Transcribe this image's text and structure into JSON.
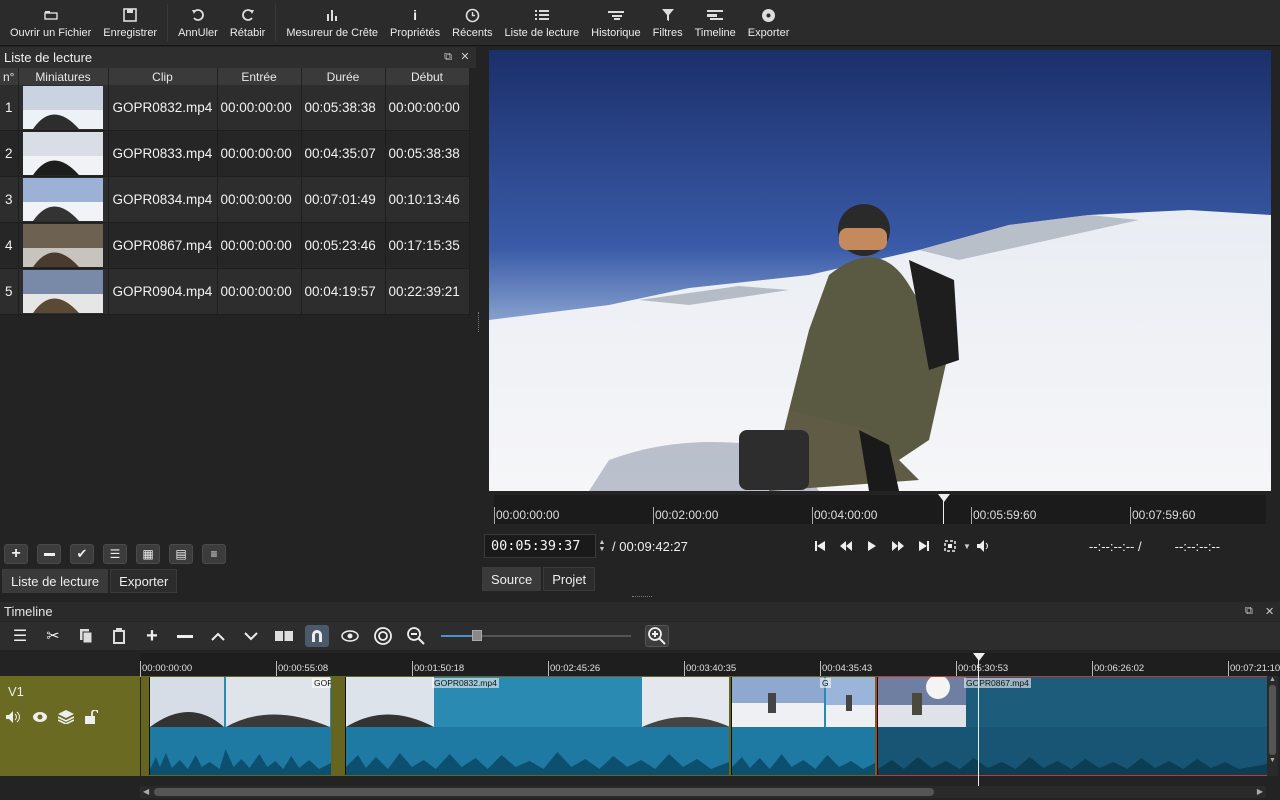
{
  "toolbar": {
    "open": "Ouvrir un Fichier",
    "save": "Enregistrer",
    "undo": "AnnUler",
    "redo": "Rétabir",
    "peak": "Mesureur de Crête",
    "properties": "Propriétés",
    "recent": "Récents",
    "playlist": "Liste de lecture",
    "history": "Historique",
    "filters": "Filtres",
    "timeline": "Timeline",
    "export": "Exporter"
  },
  "playlist": {
    "title": "Liste de lecture",
    "columns": [
      "n°",
      "Miniatures",
      "Clip",
      "Entrée",
      "Durée",
      "Début"
    ],
    "rows": [
      {
        "n": "1",
        "clip": "GOPR0832.mp4",
        "in": "00:00:00:00",
        "duration": "00:05:38:38",
        "start": "00:00:00:00"
      },
      {
        "n": "2",
        "clip": "GOPR0833.mp4",
        "in": "00:00:00:00",
        "duration": "00:04:35:07",
        "start": "00:05:38:38"
      },
      {
        "n": "3",
        "clip": "GOPR0834.mp4",
        "in": "00:00:00:00",
        "duration": "00:07:01:49",
        "start": "00:10:13:46"
      },
      {
        "n": "4",
        "clip": "GOPR0867.mp4",
        "in": "00:00:00:00",
        "duration": "00:05:23:46",
        "start": "00:17:15:35"
      },
      {
        "n": "5",
        "clip": "GOPR0904.mp4",
        "in": "00:00:00:00",
        "duration": "00:04:19:57",
        "start": "00:22:39:21"
      }
    ],
    "tab_playlist": "Liste de lecture",
    "tab_export": "Exporter"
  },
  "viewer": {
    "ruler_labels": [
      "00:00:00:00",
      "00:02:00:00",
      "00:04:00:00",
      "00:05:59:60",
      "00:07:59:60"
    ],
    "timecode": "00:05:39:37",
    "total": "/ 00:09:42:27",
    "in_point": "--:--:--:-- /",
    "out_point": "--:--:--:--",
    "tab_source": "Source",
    "tab_project": "Projet"
  },
  "timeline": {
    "title": "Timeline",
    "ruler_labels": [
      "00:00:00:00",
      "00:00:55:08",
      "00:01:50:18",
      "00:02:45:26",
      "00:03:40:35",
      "00:04:35:43",
      "00:05:30:53",
      "00:06:26:02",
      "00:07:21:10"
    ],
    "track_name": "V1",
    "clip_names": [
      "GOP",
      "GOPR0832.mp4",
      "G",
      "GOPR0867.mp4"
    ]
  }
}
